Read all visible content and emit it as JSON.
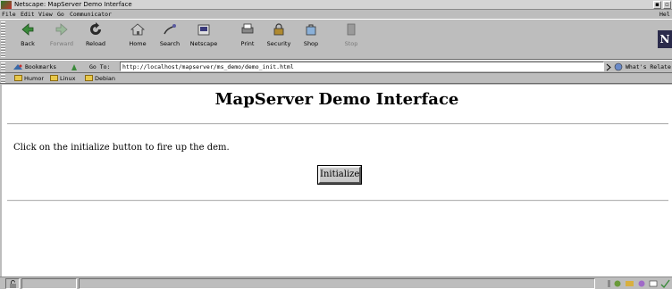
{
  "window": {
    "title": "Netscape: MapServer Demo Interface",
    "minimize": "▪",
    "close": "▫"
  },
  "menu": {
    "items": [
      "File",
      "Edit",
      "View",
      "Go",
      "Communicator"
    ],
    "help": "Hel"
  },
  "toolbar": {
    "buttons": [
      "Back",
      "Forward",
      "Reload",
      "Home",
      "Search",
      "Netscape",
      "Print",
      "Security",
      "Shop",
      "Stop"
    ],
    "logo": "N"
  },
  "location": {
    "bookmarks_label": "Bookmarks",
    "goto_label": "Go To:",
    "url": "http://localhost/mapserver/ms_demo/demo_init.html",
    "whats_related": "What's Relate"
  },
  "personal_toolbar": {
    "items": [
      "Humor",
      "Linux",
      "Debian"
    ]
  },
  "page": {
    "title": "MapServer Demo Interface",
    "instruction": "Click on the initialize button to fire up the dem.",
    "button_label": "Initialize"
  },
  "status": {
    "text": ""
  },
  "colors": {
    "chrome": "#bdbdbd",
    "content_bg": "#ffffff"
  }
}
